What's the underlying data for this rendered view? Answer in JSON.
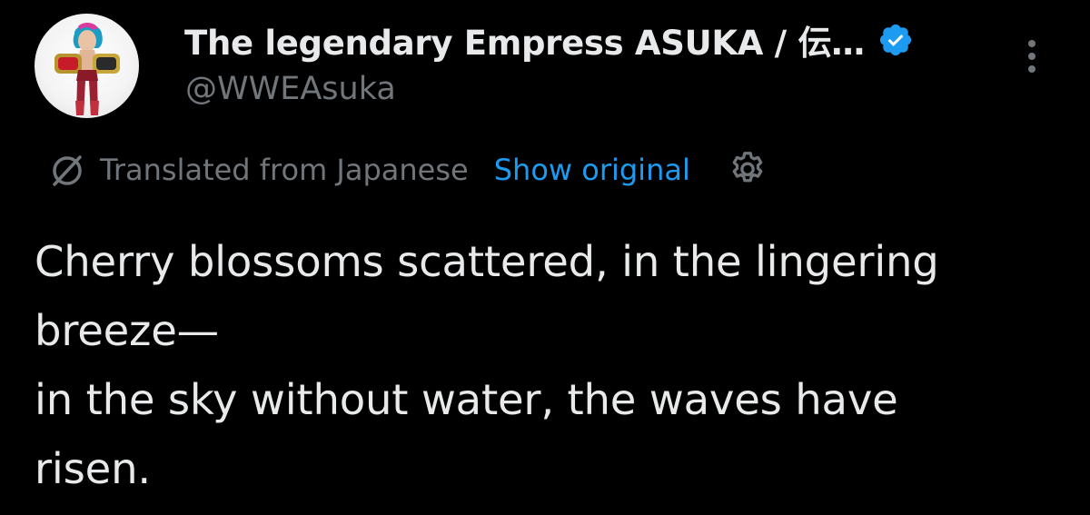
{
  "user": {
    "display_name": "The legendary Empress ASUKA / 伝…",
    "handle": "@WWEAsuka",
    "verified": true
  },
  "translation": {
    "label": "Translated from Japanese",
    "show_original": "Show original"
  },
  "tweet": {
    "text": "Cherry blossoms scattered, in the lingering\nbreeze—\nin the sky without water, the waves have\nrisen."
  },
  "icons": {
    "avatar": "avatar",
    "verified": "verified-badge-icon",
    "more": "more-options-icon",
    "translate": "translate-icon",
    "settings": "gear-icon"
  },
  "colors": {
    "background": "#000000",
    "text": "#e7e9ea",
    "secondary": "#71767b",
    "accent": "#1d9bf0"
  }
}
